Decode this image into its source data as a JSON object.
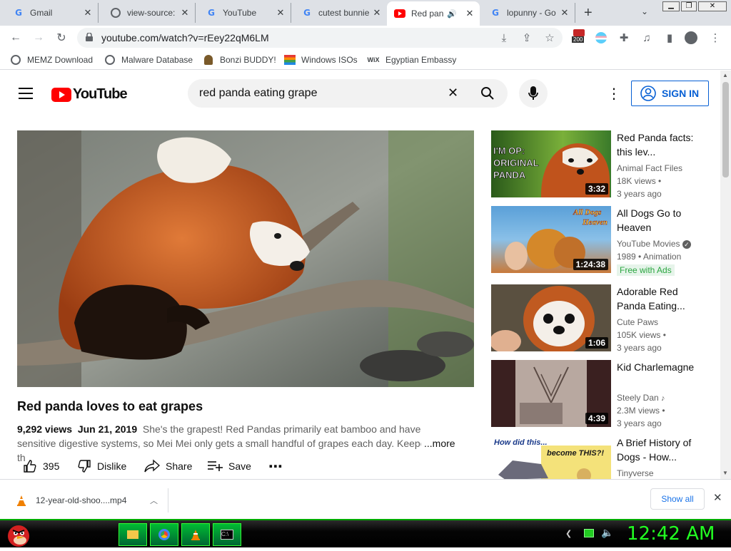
{
  "browser": {
    "tabs": [
      {
        "title": "Gmail",
        "icon": "google-g-icon"
      },
      {
        "title": "view-source:",
        "icon": "globe-icon"
      },
      {
        "title": "YouTube",
        "icon": "google-g-icon"
      },
      {
        "title": "cutest bunnie",
        "icon": "google-g-icon"
      },
      {
        "title": "Red pan",
        "icon": "youtube-icon",
        "active": true
      },
      {
        "title": "lopunny - Go",
        "icon": "google-g-icon"
      }
    ],
    "url": "youtube.com/watch?v=rEey22qM6LM",
    "ext_badge": "200",
    "bookmarks": [
      "MEMZ Download",
      "Malware Database",
      "Bonzi BUDDY!",
      "Windows ISOs",
      "Egyptian Embassy"
    ],
    "bookmark_wix": "WiX"
  },
  "youtube": {
    "logo_text": "YouTube",
    "search_query": "red panda eating grape",
    "sign_in": "SIGN IN",
    "video": {
      "title": "Red panda loves to eat grapes",
      "views": "9,292 views",
      "date": "Jun 21, 2019",
      "description": "She's the grapest! Red Pandas primarily eat bamboo and have sensitive digestive systems, so Mei Mei only gets a small handful of grapes each day. Keepers cut th",
      "more": "...more",
      "likes": "395",
      "dislike": "Dislike",
      "share": "Share",
      "save": "Save"
    },
    "recommendations": [
      {
        "title": "Red Panda facts: this lev...",
        "channel": "Animal Fact Files",
        "views": "18K views •",
        "age": "3 years ago",
        "duration": "3:32",
        "thumb_text": "I'M OP: ORIGINAL PANDA"
      },
      {
        "title": "All Dogs Go to Heaven",
        "channel": "YouTube Movies",
        "views": "1989 • Animation",
        "age": "",
        "duration": "1:24:38",
        "badge": "Free with Ads",
        "thumb_text": "All Dogs Go to Heaven"
      },
      {
        "title": "Adorable Red Panda Eating...",
        "channel": "Cute Paws",
        "views": "105K views •",
        "age": "3 years ago",
        "duration": "1:06"
      },
      {
        "title": "Kid Charlemagne",
        "channel": "Steely Dan",
        "views": "2.3M views •",
        "age": "3 years ago",
        "duration": "4:39"
      },
      {
        "title": "A Brief History of Dogs - How...",
        "channel": "Tinyverse",
        "views": "",
        "age": "",
        "duration": "",
        "thumb_text_1": "How did this...",
        "thumb_text_2": "become THIS?!"
      }
    ]
  },
  "download": {
    "filename": "12-year-old-shoo....mp4",
    "show_all": "Show all"
  },
  "taskbar": {
    "clock": "12:42 AM"
  },
  "colors": {
    "youtube_red": "#ff0000",
    "link_blue": "#065fd4",
    "clock_green": "#22ff22"
  }
}
